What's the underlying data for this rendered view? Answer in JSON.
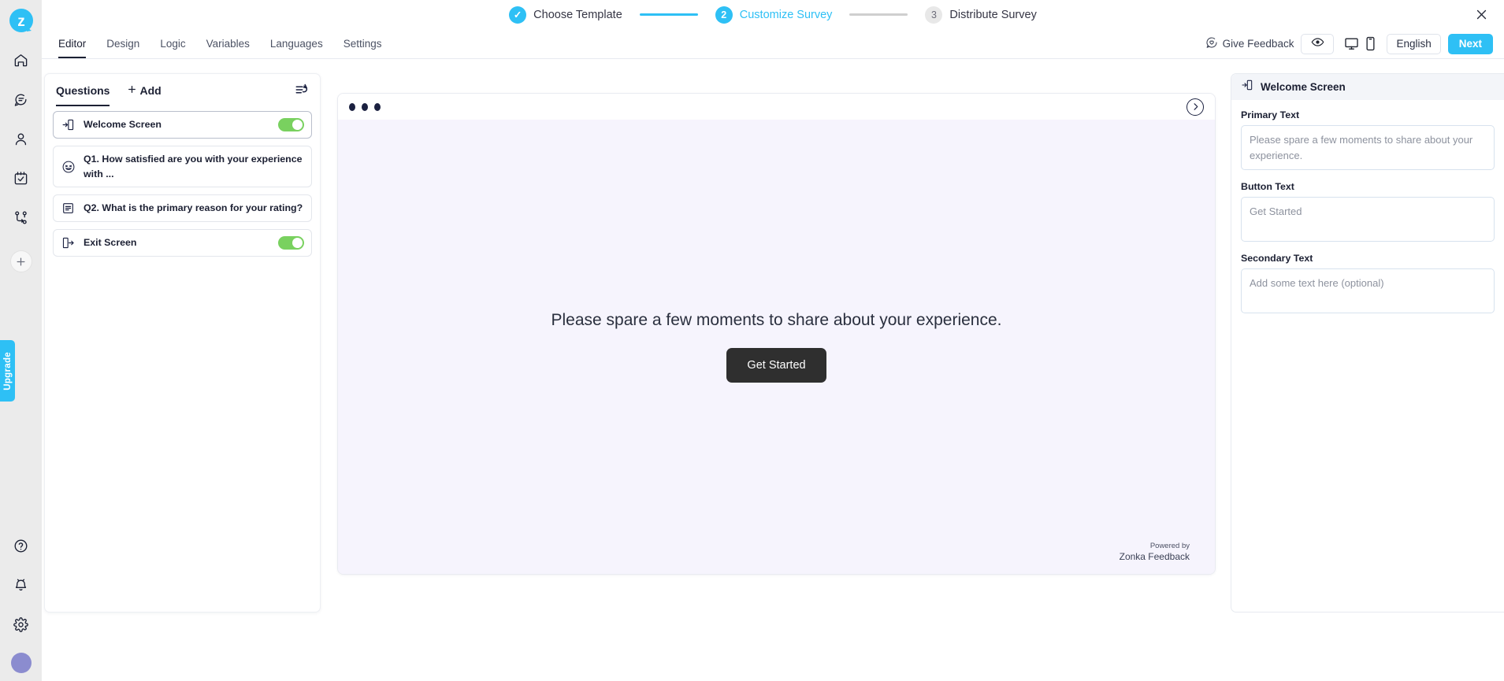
{
  "rail": {
    "logo": "zonka-logo",
    "items": [
      {
        "name": "home-icon",
        "label": "Home"
      },
      {
        "name": "feedback-icon",
        "label": "Feedback"
      },
      {
        "name": "contacts-icon",
        "label": "Contacts"
      },
      {
        "name": "tasks-icon",
        "label": "Tasks"
      },
      {
        "name": "workflows-icon",
        "label": "Workflows"
      }
    ],
    "add_label": "+",
    "upgrade_label": "Upgrade",
    "bottom_items": [
      {
        "name": "help-icon",
        "label": "Help"
      },
      {
        "name": "notifications-icon",
        "label": "Notifications"
      },
      {
        "name": "settings-icon",
        "label": "Settings"
      }
    ]
  },
  "stepper": {
    "steps": [
      {
        "badge": "✓",
        "label": "Choose Template",
        "state": "done"
      },
      {
        "badge": "2",
        "label": "Customize Survey",
        "state": "active"
      },
      {
        "badge": "3",
        "label": "Distribute Survey",
        "state": "todo"
      }
    ],
    "close_label": "✕"
  },
  "toolbar": {
    "tabs": [
      {
        "label": "Editor",
        "active": true
      },
      {
        "label": "Design",
        "active": false
      },
      {
        "label": "Logic",
        "active": false
      },
      {
        "label": "Variables",
        "active": false
      },
      {
        "label": "Languages",
        "active": false
      },
      {
        "label": "Settings",
        "active": false
      }
    ],
    "give_feedback_label": "Give Feedback",
    "preview_icon": "eye-icon",
    "desktop_icon": "desktop-icon",
    "mobile_icon": "mobile-icon",
    "language_value": "English",
    "next_label": "Next"
  },
  "questions_panel": {
    "tab_label": "Questions",
    "add_label": "Add",
    "add_plus": "+",
    "reorder_icon": "reorder-icon",
    "items": [
      {
        "icon": "welcome-screen-icon",
        "text": "Welcome Screen",
        "toggle": true,
        "selected": true
      },
      {
        "icon": "smiley-rating-icon",
        "text": "Q1. How satisfied are you with your experience with ...",
        "toggle": false,
        "selected": false
      },
      {
        "icon": "long-text-icon",
        "text": "Q2. What is the primary reason for your rating?",
        "toggle": false,
        "selected": false
      },
      {
        "icon": "exit-screen-icon",
        "text": "Exit Screen",
        "toggle": true,
        "selected": false
      }
    ]
  },
  "preview": {
    "dots_count": 3,
    "next_arrow": "›",
    "primary_text": "Please spare a few moments to share about your experience.",
    "button_text": "Get Started",
    "powered_label": "Powered by",
    "powered_brand": "Zonka Feedback"
  },
  "right_panel": {
    "header_icon": "welcome-screen-icon",
    "header_title": "Welcome Screen",
    "fields": [
      {
        "label": "Primary Text",
        "value": "",
        "placeholder": "Please spare a few moments to share about your experience."
      },
      {
        "label": "Button Text",
        "value": "",
        "placeholder": "Get Started"
      },
      {
        "label": "Secondary Text",
        "value": "",
        "placeholder": "Add some text here (optional)"
      }
    ]
  },
  "colors": {
    "accent": "#2ec0f5",
    "toggle_on": "#79d15f",
    "preview_bg": "#f6f4fd",
    "dark_button": "#2f2f2f",
    "avatar": "#8b8ccf"
  }
}
